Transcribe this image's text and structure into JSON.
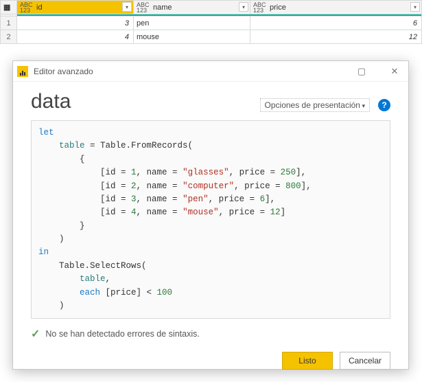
{
  "grid": {
    "columns": [
      "id",
      "name",
      "price"
    ],
    "type_label_top": "ABC",
    "type_label_bottom": "123",
    "rows": [
      {
        "n": "1",
        "id": "3",
        "name": "pen",
        "price": "6"
      },
      {
        "n": "2",
        "id": "4",
        "name": "mouse",
        "price": "12"
      }
    ]
  },
  "dialog": {
    "title": "Editor avanzado",
    "query_name": "data",
    "options_label": "Opciones de presentación",
    "status_text": "No se han detectado errores de sintaxis.",
    "ok_label": "Listo",
    "cancel_label": "Cancelar",
    "code": {
      "kw_let": "let",
      "kw_in": "in",
      "var_table": "table",
      "fn_from": "Table.FromRecords",
      "fn_select": "Table.SelectRows",
      "kw_each": "each",
      "field_id": "id",
      "field_name": "name",
      "field_price": "price",
      "records": [
        {
          "id": "1",
          "name": "\"glasses\"",
          "price": "250"
        },
        {
          "id": "2",
          "name": "\"computer\"",
          "price": "800"
        },
        {
          "id": "3",
          "name": "\"pen\"",
          "price": "6"
        },
        {
          "id": "4",
          "name": "\"mouse\"",
          "price": "12"
        }
      ],
      "filter_value": "100",
      "filter_op": "<"
    }
  }
}
